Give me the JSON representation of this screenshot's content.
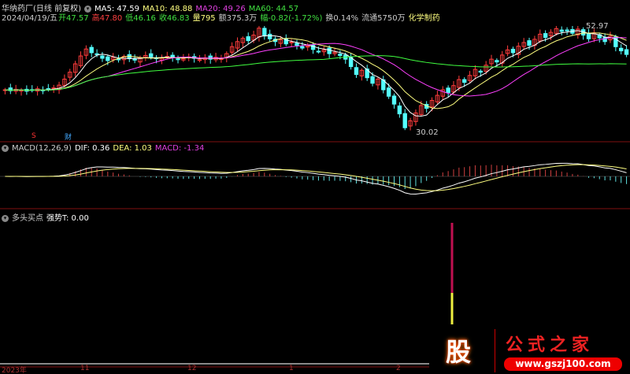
{
  "header": {
    "stock": "华纳药厂(日线 前复权)",
    "ma5": "MA5: 47.59",
    "ma10": "MA10: 48.88",
    "ma20": "MA20: 49.26",
    "ma60": "MA60: 44.57",
    "date": "2024/04/19/五",
    "open": "开47.57",
    "high": "高47.80",
    "low": "低46.16",
    "close": "收46.83",
    "vol": "量795",
    "amount": "额375.3万",
    "change": "幅-0.82(-1.72%)",
    "turnover": "换0.14%",
    "float": "流通5750万",
    "sector": "化学制药"
  },
  "price_labels": {
    "high": "52.97",
    "low": "30.02",
    "marker_s": "S",
    "marker_cai": "财"
  },
  "macd": {
    "title": "MACD(12,26,9)",
    "dif": "DIF: 0.36",
    "dea": "DEA: 1.03",
    "macd": "MACD: -1.34"
  },
  "indicator": {
    "title": "多头买点",
    "value": "强势T: 0.00",
    "signal_fraction": 1.0
  },
  "time_axis": [
    "2023年",
    "11",
    "12",
    "1",
    "2"
  ],
  "logo": {
    "char": "股",
    "name": "公式之家",
    "url": "www.gszj100.com"
  },
  "colors": {
    "up": "#ff3c3c",
    "down": "#54ffff",
    "ma5": "#ffffff",
    "ma10": "#ffff80",
    "ma20": "#ff40ff",
    "ma60": "#40ff40"
  },
  "chart_data": {
    "type": "candlestick",
    "closes": [
      39.2,
      39.0,
      39.3,
      39.1,
      38.9,
      39.2,
      39.4,
      39.1,
      39.3,
      39.6,
      40.2,
      41.5,
      43.0,
      44.8,
      46.5,
      48.0,
      47.2,
      46.8,
      46.0,
      45.5,
      46.2,
      45.8,
      46.4,
      45.9,
      45.6,
      46.1,
      46.6,
      46.3,
      45.9,
      46.0,
      46.4,
      46.2,
      45.8,
      45.9,
      46.3,
      46.0,
      45.7,
      46.1,
      45.8,
      46.2,
      45.9,
      47.0,
      48.5,
      49.6,
      50.3,
      49.8,
      51.0,
      52.5,
      50.8,
      50.2,
      49.6,
      50.0,
      49.1,
      49.5,
      48.8,
      48.2,
      48.6,
      47.9,
      47.5,
      47.8,
      47.0,
      47.3,
      46.6,
      45.8,
      44.2,
      42.5,
      43.4,
      41.8,
      40.6,
      41.5,
      39.2,
      37.8,
      36.1,
      34.0,
      31.0,
      32.5,
      34.2,
      35.8,
      35.2,
      36.9,
      38.0,
      39.2,
      38.6,
      40.1,
      41.4,
      40.8,
      42.3,
      43.6,
      43.0,
      44.5,
      45.8,
      45.2,
      46.7,
      47.8,
      47.2,
      48.6,
      49.4,
      48.8,
      50.1,
      51.2,
      50.5,
      51.6,
      52.4,
      51.8,
      52.0,
      51.4,
      52.3,
      51.0,
      50.2,
      51.5,
      50.4,
      49.6,
      50.8,
      48.5,
      47.6,
      46.83
    ],
    "price_range": [
      30.02,
      52.97
    ]
  }
}
